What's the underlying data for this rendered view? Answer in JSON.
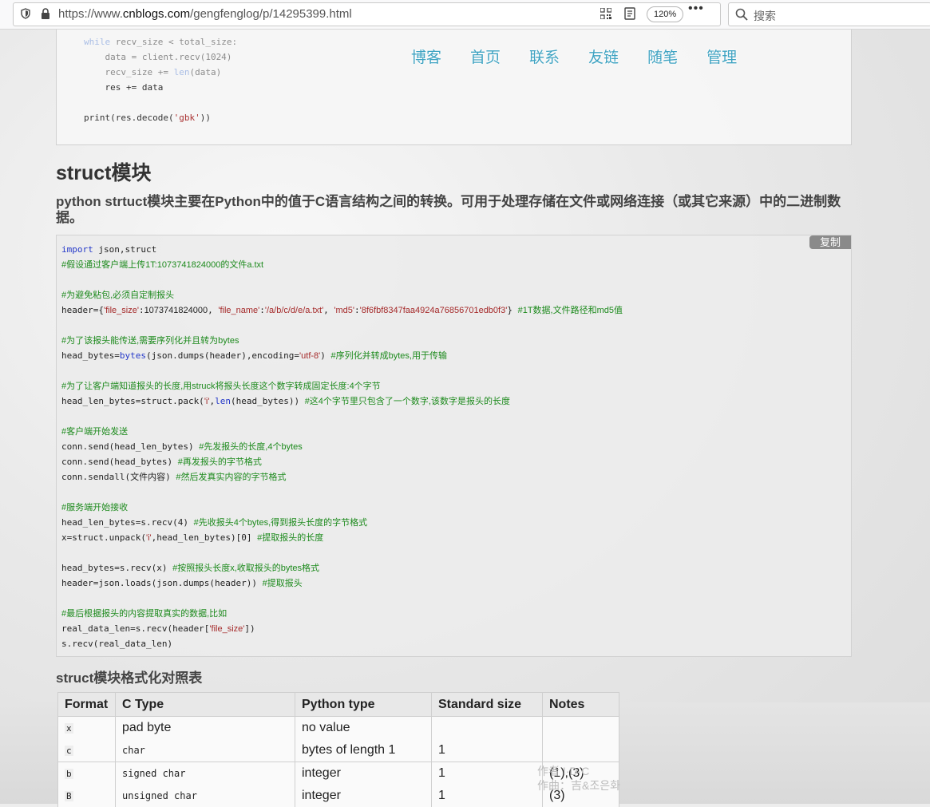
{
  "browser": {
    "url_prefix": "https://www.",
    "url_host": "cnblogs.com",
    "url_path": "/gengfenglog/p/14295399.html",
    "zoom": "120%",
    "search_placeholder": "搜索"
  },
  "nav": {
    "items": [
      "博客",
      "首页",
      "联系",
      "友链",
      "随笔",
      "管理"
    ]
  },
  "top_code": {
    "lines": [
      {
        "kw": "while",
        "rest": " recv_size < total_size:"
      },
      {
        "text": "    data = client.recv(1024)"
      },
      {
        "text": "    recv_size += ",
        "fn": "len",
        "tail": "(data)"
      },
      {
        "text": "    res += data"
      },
      {
        "text": ""
      },
      {
        "pre": "print(res.decode(",
        "str": "'gbk'",
        "post": "))"
      }
    ]
  },
  "article": {
    "heading": "struct模块",
    "subheading": "python strtuct模块主要在Python中的值于C语言结构之间的转换。可用于处理存储在文件或网络连接（或其它来源）中的二进制数据。",
    "copy_label": "复制",
    "table_heading": "struct模块格式化对照表"
  },
  "code": {
    "l1_kw": "import",
    "l1_rest": " json,struct",
    "l2": "#假设通过客户端上传1T:1073741824000的文件a.txt",
    "l4": "#为避免粘包,必须自定制报头",
    "l5_a": "header={",
    "l5_s1": "'file_size'",
    "l5_b": ":",
    "l5_v1": "1073741824000",
    "l5_c": ", ",
    "l5_s2": "'file_name'",
    "l5_d": ":",
    "l5_s3": "'/a/b/c/d/e/a.txt'",
    "l5_e": ", ",
    "l5_s4": "'md5'",
    "l5_f": ":",
    "l5_s5": "'8f6fbf8347faa4924a76856701edb0f3'",
    "l5_g": "} ",
    "l5_cm": "#1T数据,文件路径和md5值",
    "l7": "#为了该报头能传送,需要序列化并且转为bytes",
    "l8_a": "head_bytes=",
    "l8_kw": "bytes",
    "l8_b": "(json.dumps(header),encoding=",
    "l8_s": "'utf-8'",
    "l8_c": ") ",
    "l8_cm": "#序列化并转成bytes,用于传输",
    "l10": "#为了让客户端知道报头的长度,用struck将报头长度这个数字转成固定长度:4个字节",
    "l11_a": "head_len_bytes=struct.pack(",
    "l11_s": "'i'",
    "l11_b": ",",
    "l11_kw": "len",
    "l11_c": "(head_bytes)) ",
    "l11_cm": "#这4个字节里只包含了一个数字,该数字是报头的长度",
    "l13": "#客户端开始发送",
    "l14_a": "conn.send(head_len_bytes) ",
    "l14_cm": "#先发报头的长度,4个bytes",
    "l15_a": "conn.send(head_bytes) ",
    "l15_cm": "#再发报头的字节格式",
    "l16_a": "conn.sendall(文件内容) ",
    "l16_cm": "#然后发真实内容的字节格式",
    "l18": "#服务端开始接收",
    "l19_a": "head_len_bytes=s.recv(4) ",
    "l19_cm": "#先收报头4个bytes,得到报头长度的字节格式",
    "l20_a": "x=struct.unpack(",
    "l20_s": "'i'",
    "l20_b": ",head_len_bytes)[0] ",
    "l20_cm": "#提取报头的长度",
    "l22_a": "head_bytes=s.recv(x) ",
    "l22_cm": "#按照报头长度x,收取报头的bytes格式",
    "l23_a": "header=json.loads(json.dumps(header)) ",
    "l23_cm": "#提取报头",
    "l25": "#最后根据报头的内容提取真实的数据,比如",
    "l26_a": "real_data_len=s.recv(header[",
    "l26_s": "'file_size'",
    "l26_b": "])",
    "l27": "s.recv(real_data_len)"
  },
  "table": {
    "headers": [
      "Format",
      "C Type",
      "Python type",
      "Standard size",
      "Notes"
    ],
    "rows": [
      {
        "format": "x",
        "ctype": "pad byte",
        "ctype_mono": false,
        "ptype": "no value",
        "size": "",
        "notes": ""
      },
      {
        "format": "c",
        "ctype": "char",
        "ctype_mono": true,
        "ptype": "bytes of length 1",
        "size": "1",
        "notes": ""
      },
      {
        "format": "b",
        "ctype": "signed char",
        "ctype_mono": true,
        "ptype": "integer",
        "size": "1",
        "notes": "(1),(3)"
      },
      {
        "format": "B",
        "ctype": "unsigned char",
        "ctype_mono": true,
        "ptype": "integer",
        "size": "1",
        "notes": "(3)"
      }
    ]
  },
  "watermark": {
    "line1": "作者 I·D·C",
    "line2": "作曲：吉&조은화"
  }
}
